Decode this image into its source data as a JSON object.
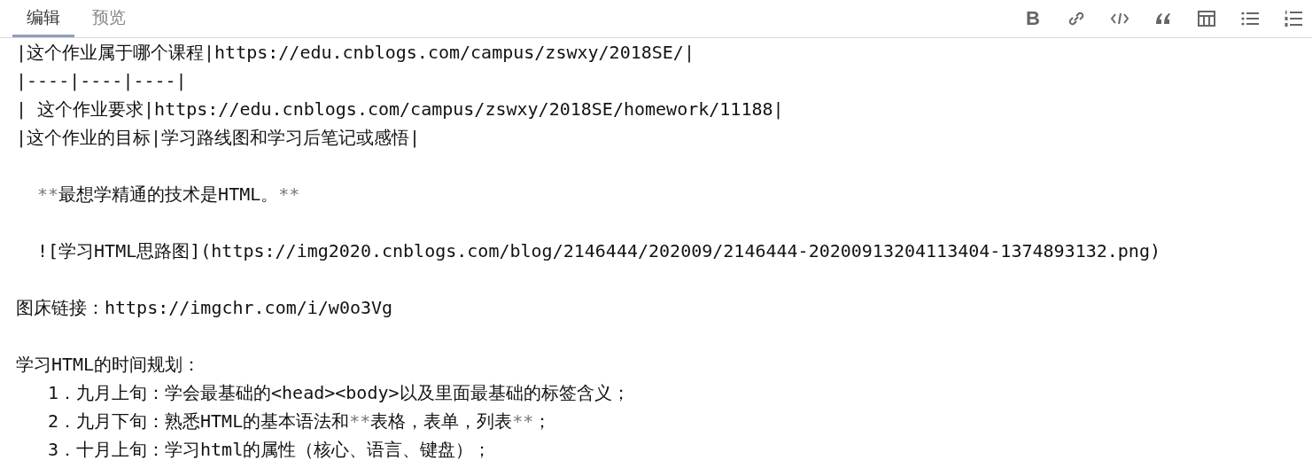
{
  "tabs": [
    {
      "label": "编辑",
      "selected": true
    },
    {
      "label": "预览",
      "selected": false
    }
  ],
  "toolbar": {
    "bold_label": "B"
  },
  "lines": [
    {
      "kind": "text",
      "text": "|这个作业属于哪个课程|https://edu.cnblogs.com/campus/zswxy/2018SE/|"
    },
    {
      "kind": "text",
      "text": "|----|----|----|"
    },
    {
      "kind": "text",
      "text": "| 这个作业要求|https://edu.cnblogs.com/campus/zswxy/2018SE/homework/11188|"
    },
    {
      "kind": "text",
      "text": "|这个作业的目标|学习路线图和学习后笔记或感悟|"
    },
    {
      "kind": "indented",
      "space_before": true,
      "parts": [
        {
          "text": "**",
          "kind": "marker"
        },
        {
          "text": "最想学精通的技术是HTML。",
          "kind": "plain"
        },
        {
          "text": "**",
          "kind": "marker"
        }
      ]
    },
    {
      "kind": "indented",
      "space_before": true,
      "text": "![学习HTML思路图](https://img2020.cnblogs.com/blog/2146444/202009/2146444-20200913204113404-1374893132.png)"
    },
    {
      "kind": "text",
      "space_before": true,
      "text": "图床链接：https://imgchr.com/i/w0o3Vg"
    },
    {
      "kind": "text",
      "space_before": true,
      "text": "学习HTML的时间规划："
    },
    {
      "kind": "list_item",
      "text": "1．九月上旬：学会最基础的<head><body>以及里面最基础的标签含义；"
    },
    {
      "kind": "list_item",
      "parts": [
        {
          "text": "2．九月下旬：熟悉HTML的基本语法和",
          "kind": "plain"
        },
        {
          "text": "**",
          "kind": "marker"
        },
        {
          "text": "表格，表单，列表",
          "kind": "plain"
        },
        {
          "text": "**",
          "kind": "marker"
        },
        {
          "text": "；",
          "kind": "plain"
        }
      ]
    },
    {
      "kind": "list_item",
      "text": "3．十月上旬：学习html的属性（核心、语言、键盘）；"
    }
  ]
}
